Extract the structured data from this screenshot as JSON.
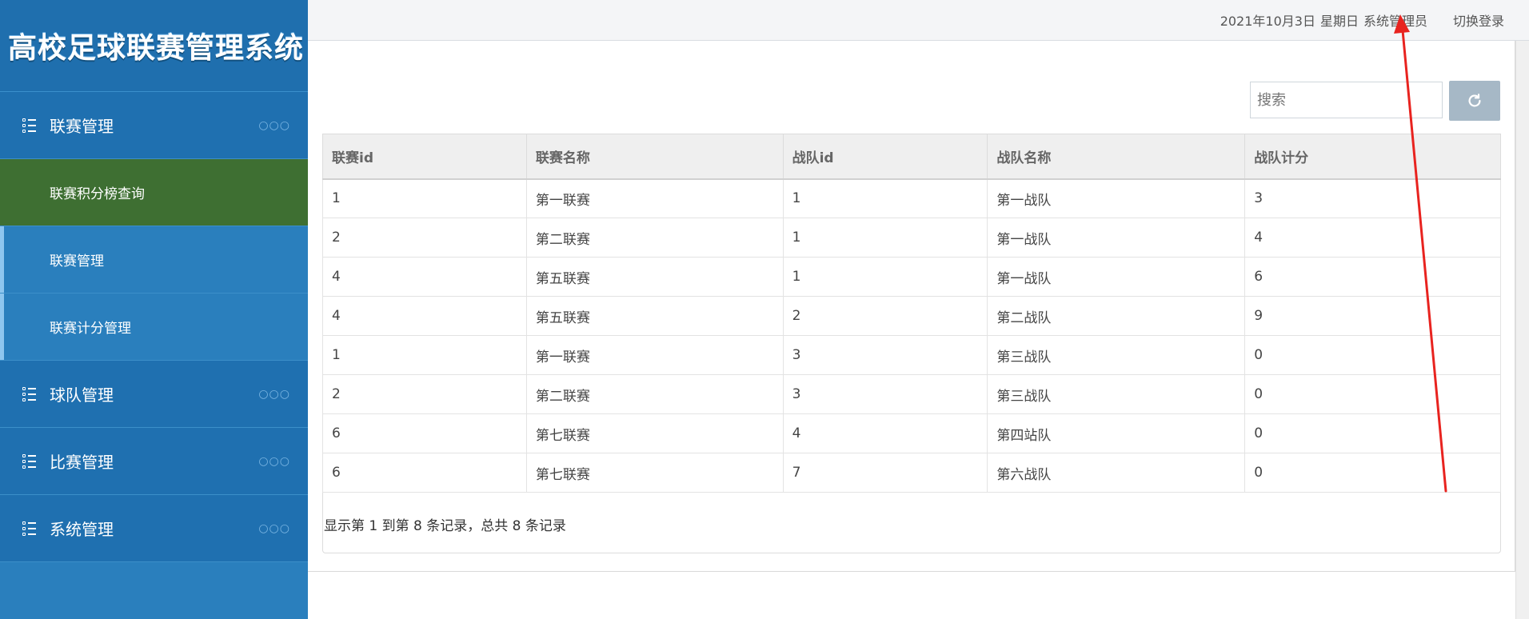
{
  "app": {
    "title": "高校足球联赛管理系统"
  },
  "sidebar": {
    "menus": [
      {
        "label": "联赛管理",
        "dots": "○○○",
        "expanded": true,
        "children": [
          {
            "label": "联赛积分榜查询",
            "active": true
          },
          {
            "label": "联赛管理",
            "active": false
          },
          {
            "label": "联赛计分管理",
            "active": false
          }
        ]
      },
      {
        "label": "球队管理",
        "dots": "○○○"
      },
      {
        "label": "比赛管理",
        "dots": "○○○"
      },
      {
        "label": "系统管理",
        "dots": "○○○"
      }
    ],
    "colors": {
      "bg": "#2a7fbd",
      "menu_bg": "#1f70b0",
      "active_bg": "#3e6f32"
    }
  },
  "topbar": {
    "date": "2021年10月3日",
    "weekday": "星期日",
    "user": "系统管理员",
    "switch_login": "切换登录"
  },
  "search": {
    "placeholder": "搜索",
    "refresh_icon": "refresh-icon"
  },
  "table": {
    "headers": [
      "联赛id",
      "联赛名称",
      "战队id",
      "战队名称",
      "战队计分"
    ],
    "rows": [
      [
        "1",
        "第一联赛",
        "1",
        "第一战队",
        "3"
      ],
      [
        "2",
        "第二联赛",
        "1",
        "第一战队",
        "4"
      ],
      [
        "4",
        "第五联赛",
        "1",
        "第一战队",
        "6"
      ],
      [
        "4",
        "第五联赛",
        "2",
        "第二战队",
        "9"
      ],
      [
        "1",
        "第一联赛",
        "3",
        "第三战队",
        "0"
      ],
      [
        "2",
        "第二联赛",
        "3",
        "第三战队",
        "0"
      ],
      [
        "6",
        "第七联赛",
        "4",
        "第四站队",
        "0"
      ],
      [
        "6",
        "第七联赛",
        "7",
        "第六战队",
        "0"
      ]
    ]
  },
  "pagination": {
    "summary": "显示第 1 到第 8 条记录，总共 8 条记录"
  },
  "annotation": {
    "color": "#e8231f"
  }
}
